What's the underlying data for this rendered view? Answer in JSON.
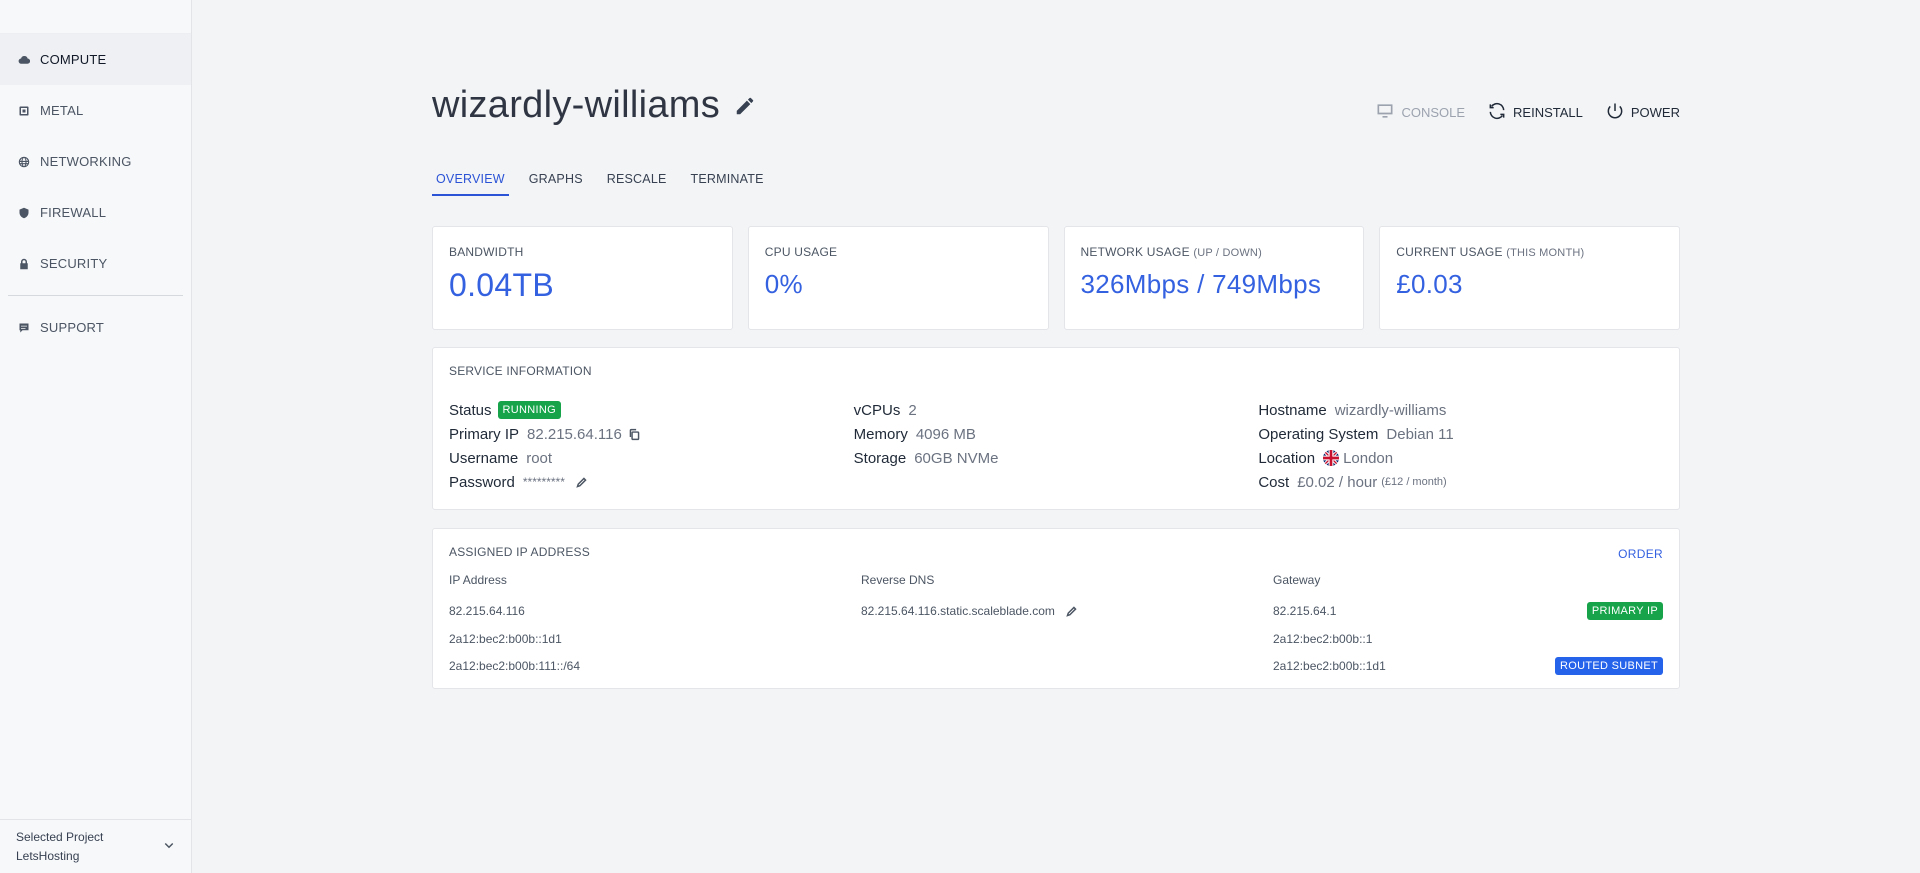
{
  "sidebar": {
    "items": [
      {
        "label": "COMPUTE",
        "icon": "cloud-icon"
      },
      {
        "label": "METAL",
        "icon": "chip-icon"
      },
      {
        "label": "NETWORKING",
        "icon": "globe-icon"
      },
      {
        "label": "FIREWALL",
        "icon": "shield-icon"
      },
      {
        "label": "SECURITY",
        "icon": "lock-icon"
      },
      {
        "label": "SUPPORT",
        "icon": "chat-icon"
      }
    ],
    "project": {
      "caption": "Selected Project",
      "name": "LetsHosting"
    }
  },
  "header": {
    "title": "wizardly-williams",
    "actions": {
      "console": "CONSOLE",
      "reinstall": "REINSTALL",
      "power": "POWER"
    }
  },
  "tabs": [
    "OVERVIEW",
    "GRAPHS",
    "RESCALE",
    "TERMINATE"
  ],
  "stats": {
    "bandwidth": {
      "label": "BANDWIDTH",
      "value": "0.04TB"
    },
    "cpu": {
      "label": "CPU USAGE",
      "value": "0%"
    },
    "network": {
      "label": "NETWORK USAGE",
      "sub": "(UP / DOWN)",
      "value": "326Mbps / 749Mbps"
    },
    "current": {
      "label": "CURRENT USAGE",
      "sub": "(THIS MONTH)",
      "value": "£0.03"
    }
  },
  "service": {
    "title": "SERVICE INFORMATION",
    "status_label": "Status",
    "status_value": "RUNNING",
    "ip_label": "Primary IP",
    "ip_value": "82.215.64.116",
    "user_label": "Username",
    "user_value": "root",
    "pass_label": "Password",
    "pass_value": "*********",
    "vcpu_label": "vCPUs",
    "vcpu_value": "2",
    "mem_label": "Memory",
    "mem_value": "4096 MB",
    "storage_label": "Storage",
    "storage_value": "60GB NVMe",
    "host_label": "Hostname",
    "host_value": "wizardly-williams",
    "os_label": "Operating System",
    "os_value": "Debian 11",
    "loc_label": "Location",
    "loc_value": "London",
    "cost_label": "Cost",
    "cost_value": "£0.02 / hour",
    "cost_month": "(£12 / month)"
  },
  "ips": {
    "title": "ASSIGNED IP ADDRESS",
    "order": "ORDER",
    "headers": {
      "ip": "IP Address",
      "rdns": "Reverse DNS",
      "gateway": "Gateway"
    },
    "rows": [
      {
        "ip": "82.215.64.116",
        "rdns": "82.215.64.116.static.scaleblade.com",
        "gateway": "82.215.64.1",
        "tag": "PRIMARY IP"
      },
      {
        "ip": "2a12:bec2:b00b::1d1",
        "rdns": "",
        "gateway": "2a12:bec2:b00b::1",
        "tag": ""
      },
      {
        "ip": "2a12:bec2:b00b:111::/64",
        "rdns": "",
        "gateway": "2a12:bec2:b00b::1d1",
        "tag": "ROUTED SUBNET"
      }
    ]
  },
  "colors": {
    "accent": "#3461e0",
    "running": "#16a34a",
    "routed": "#2563eb"
  }
}
